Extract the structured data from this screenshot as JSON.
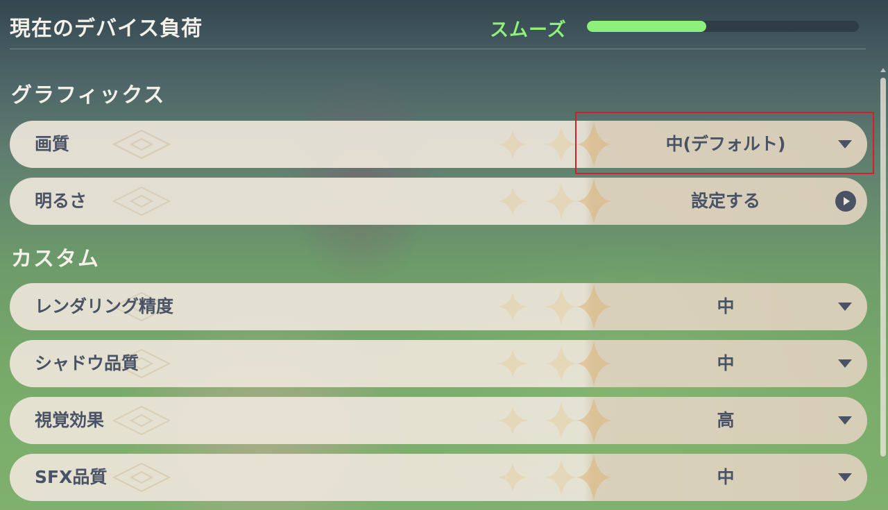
{
  "header": {
    "title": "現在のデバイス負荷",
    "load_status": "スムーズ",
    "load_level": 0.44
  },
  "sections": {
    "graphics": {
      "title": "グラフィックス",
      "rows": [
        {
          "label": "画質",
          "value": "中(デフォルト)",
          "control": "dropdown",
          "highlighted": true
        },
        {
          "label": "明るさ",
          "value": "設定する",
          "control": "link"
        }
      ]
    },
    "custom": {
      "title": "カスタム",
      "rows": [
        {
          "label": "レンダリング精度",
          "value": "中",
          "control": "dropdown"
        },
        {
          "label": "シャドウ品質",
          "value": "中",
          "control": "dropdown"
        },
        {
          "label": "視覚効果",
          "value": "高",
          "control": "dropdown"
        },
        {
          "label": "SFX品質",
          "value": "中",
          "control": "dropdown"
        }
      ]
    }
  },
  "icons": {
    "dropdown": "caret-down-icon",
    "link": "arrow-right-circle-icon"
  },
  "colors": {
    "accent_green": "#8cf07b",
    "highlight_red": "#d41f2a",
    "row_text": "#4a5366"
  }
}
